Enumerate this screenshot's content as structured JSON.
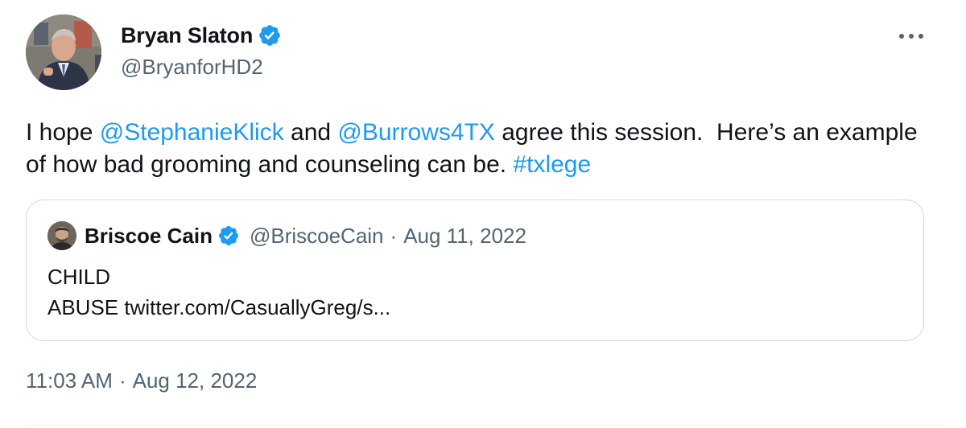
{
  "author": {
    "name": "Bryan Slaton",
    "handle": "@BryanforHD2",
    "verified": true,
    "avatar_icon": "profile-photo"
  },
  "tweet": {
    "text_parts": [
      {
        "text": "I hope ",
        "type": "plain"
      },
      {
        "text": "@StephanieKlick",
        "type": "mention"
      },
      {
        "text": " and ",
        "type": "plain"
      },
      {
        "text": "@Burrows4TX",
        "type": "mention"
      },
      {
        "text": " agree this session.  Here’s an example of how bad grooming and counseling can be. ",
        "type": "plain"
      },
      {
        "text": "#txlege",
        "type": "hashtag"
      }
    ]
  },
  "quote": {
    "name": "Briscoe Cain",
    "handle": "@BriscoeCain",
    "separator": "·",
    "date": "Aug 11, 2022",
    "line1": "CHILD",
    "line2": "ABUSE twitter.com/CasuallyGreg/s..."
  },
  "meta": {
    "time": "11:03 AM",
    "separator": "·",
    "date": "Aug 12, 2022"
  },
  "colors": {
    "link": "#1d9bf0",
    "verified_badge": "#1d9bf0",
    "secondary_text": "#536471",
    "border": "#cfd9de"
  }
}
